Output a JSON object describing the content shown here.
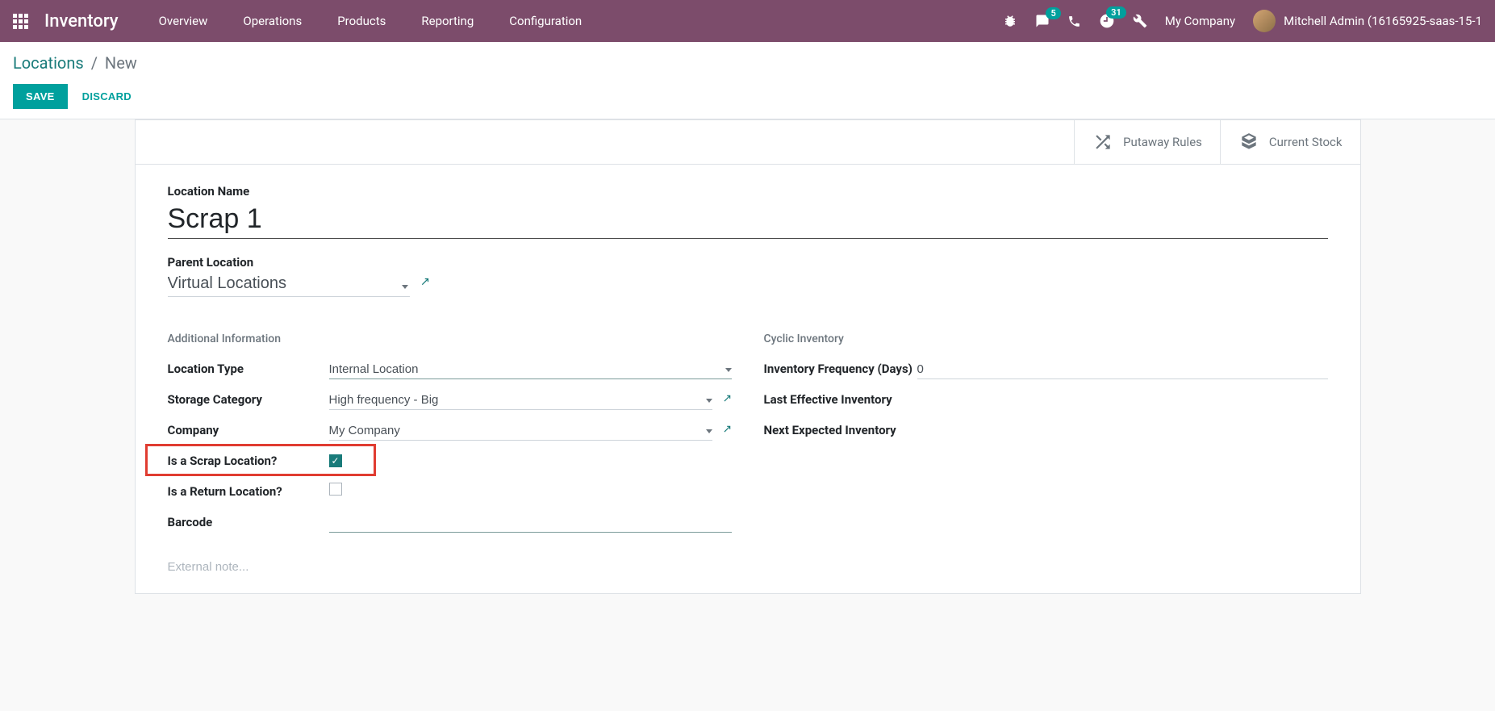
{
  "topbar": {
    "app_title": "Inventory",
    "menu": [
      "Overview",
      "Operations",
      "Products",
      "Reporting",
      "Configuration"
    ],
    "msg_badge": "5",
    "activity_badge": "31",
    "company": "My Company",
    "user": "Mitchell Admin (16165925-saas-15-1"
  },
  "breadcrumb": {
    "root": "Locations",
    "current": "New"
  },
  "buttons": {
    "save": "SAVE",
    "discard": "DISCARD"
  },
  "stat_buttons": {
    "putaway": "Putaway Rules",
    "current_stock": "Current Stock"
  },
  "form": {
    "location_name_label": "Location Name",
    "location_name_value": "Scrap 1",
    "parent_location_label": "Parent Location",
    "parent_location_value": "Virtual Locations",
    "sections": {
      "additional": "Additional Information",
      "cyclic": "Cyclic Inventory"
    },
    "left": {
      "location_type_label": "Location Type",
      "location_type_value": "Internal Location",
      "storage_category_label": "Storage Category",
      "storage_category_value": "High frequency - Big",
      "company_label": "Company",
      "company_value": "My Company",
      "scrap_label": "Is a Scrap Location?",
      "return_label": "Is a Return Location?",
      "barcode_label": "Barcode",
      "barcode_value": ""
    },
    "right": {
      "freq_label": "Inventory Frequency (Days)",
      "freq_value": "0",
      "last_label": "Last Effective Inventory",
      "last_value": "",
      "next_label": "Next Expected Inventory",
      "next_value": ""
    },
    "note_placeholder": "External note..."
  }
}
